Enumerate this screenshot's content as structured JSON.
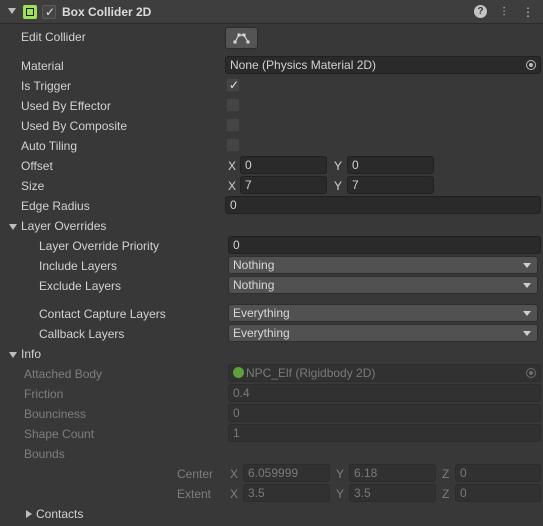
{
  "header": {
    "title": "Box Collider 2D",
    "icons": [
      "help-icon",
      "preset-icon",
      "more-icon"
    ]
  },
  "props": {
    "edit_collider": "Edit Collider",
    "material": "Material",
    "material_value": "None (Physics Material 2D)",
    "is_trigger": "Is Trigger",
    "is_trigger_checked": true,
    "used_by_effector": "Used By Effector",
    "used_by_composite": "Used By Composite",
    "auto_tiling": "Auto Tiling",
    "offset": "Offset",
    "offset_x": "0",
    "offset_y": "0",
    "size": "Size",
    "size_x": "7",
    "size_y": "7",
    "edge_radius": "Edge Radius",
    "edge_radius_value": "0",
    "axis_x": "X",
    "axis_y": "Y",
    "axis_z": "Z"
  },
  "layer_overrides": {
    "title": "Layer Overrides",
    "priority_label": "Layer Override Priority",
    "priority_value": "0",
    "include_label": "Include Layers",
    "include_value": "Nothing",
    "exclude_label": "Exclude Layers",
    "exclude_value": "Nothing",
    "contact_label": "Contact Capture Layers",
    "contact_value": "Everything",
    "callback_label": "Callback Layers",
    "callback_value": "Everything"
  },
  "info": {
    "title": "Info",
    "attached_body_label": "Attached Body",
    "attached_body_value": "NPC_Elf (Rigidbody 2D)",
    "friction_label": "Friction",
    "friction_value": "0.4",
    "bounciness_label": "Bounciness",
    "bounciness_value": "0",
    "shape_count_label": "Shape Count",
    "shape_count_value": "1",
    "bounds_label": "Bounds",
    "center_label": "Center",
    "center_x": "6.059999",
    "center_y": "6.18",
    "center_z": "0",
    "extent_label": "Extent",
    "extent_x": "3.5",
    "extent_y": "3.5",
    "extent_z": "0",
    "contacts_label": "Contacts"
  }
}
